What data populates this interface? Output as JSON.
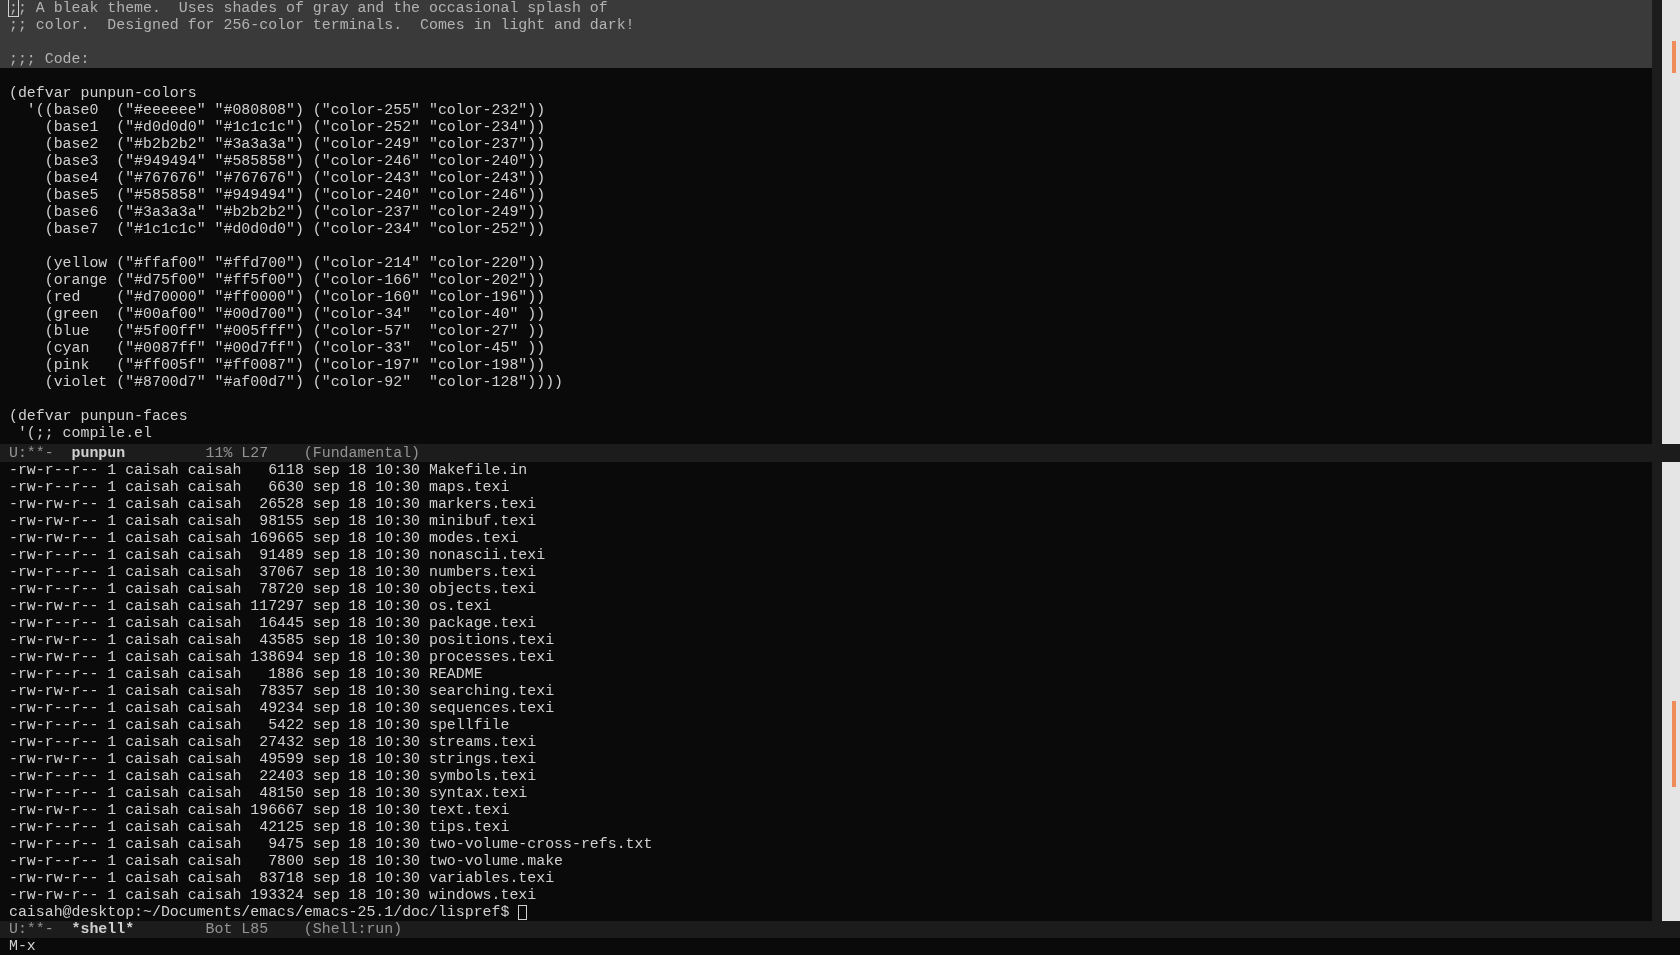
{
  "editor": {
    "lines": [
      {
        "text": ";; A bleak theme.  Uses shades of gray and the occasional splash of",
        "region": true,
        "cursor": true
      },
      {
        "text": ";; color.  Designed for 256-color terminals.  Comes in light and dark!",
        "region": true,
        "cursor": false
      },
      {
        "region": true
      },
      {
        "text": ";;; Code:",
        "region": true,
        "cursor": false
      },
      {
        "region": false
      },
      {
        "text": "(defvar punpun-colors",
        "region": false,
        "cursor": false
      },
      {
        "text": "  '((base0  (\"#eeeeee\" \"#080808\") (\"color-255\" \"color-232\"))",
        "region": false,
        "cursor": false
      },
      {
        "text": "    (base1  (\"#d0d0d0\" \"#1c1c1c\") (\"color-252\" \"color-234\"))",
        "region": false,
        "cursor": false
      },
      {
        "text": "    (base2  (\"#b2b2b2\" \"#3a3a3a\") (\"color-249\" \"color-237\"))",
        "region": false,
        "cursor": false
      },
      {
        "text": "    (base3  (\"#949494\" \"#585858\") (\"color-246\" \"color-240\"))",
        "region": false,
        "cursor": false
      },
      {
        "text": "    (base4  (\"#767676\" \"#767676\") (\"color-243\" \"color-243\"))",
        "region": false,
        "cursor": false
      },
      {
        "text": "    (base5  (\"#585858\" \"#949494\") (\"color-240\" \"color-246\"))",
        "region": false,
        "cursor": false
      },
      {
        "text": "    (base6  (\"#3a3a3a\" \"#b2b2b2\") (\"color-237\" \"color-249\"))",
        "region": false,
        "cursor": false
      },
      {
        "text": "    (base7  (\"#1c1c1c\" \"#d0d0d0\") (\"color-234\" \"color-252\"))",
        "region": false,
        "cursor": false
      },
      {
        "region": false
      },
      {
        "text": "    (yellow (\"#ffaf00\" \"#ffd700\") (\"color-214\" \"color-220\"))",
        "region": false,
        "cursor": false
      },
      {
        "text": "    (orange (\"#d75f00\" \"#ff5f00\") (\"color-166\" \"color-202\"))",
        "region": false,
        "cursor": false
      },
      {
        "text": "    (red    (\"#d70000\" \"#ff0000\") (\"color-160\" \"color-196\"))",
        "region": false,
        "cursor": false
      },
      {
        "text": "    (green  (\"#00af00\" \"#00d700\") (\"color-34\"  \"color-40\" ))",
        "region": false,
        "cursor": false
      },
      {
        "text": "    (blue   (\"#5f00ff\" \"#005fff\") (\"color-57\"  \"color-27\" ))",
        "region": false,
        "cursor": false
      },
      {
        "text": "    (cyan   (\"#0087ff\" \"#00d7ff\") (\"color-33\"  \"color-45\" ))",
        "region": false,
        "cursor": false
      },
      {
        "text": "    (pink   (\"#ff005f\" \"#ff0087\") (\"color-197\" \"color-198\"))",
        "region": false,
        "cursor": false
      },
      {
        "text": "    (violet (\"#8700d7\" \"#af00d7\") (\"color-92\"  \"color-128\"))))",
        "region": false,
        "cursor": false
      },
      {
        "region": false
      },
      {
        "text": "(defvar punpun-faces",
        "region": false,
        "cursor": false
      },
      {
        "text": " '(;; compile.el",
        "region": false,
        "cursor": false
      }
    ],
    "mode_line": {
      "status": "U:**-",
      "buffer": "punpun",
      "position": "11% L27",
      "mode": "(Fundamental)"
    }
  },
  "shell": {
    "lines": [
      "-rw-r--r-- 1 caisah caisah   6118 sep 18 10:30 Makefile.in",
      "-rw-r--r-- 1 caisah caisah   6630 sep 18 10:30 maps.texi",
      "-rw-rw-r-- 1 caisah caisah  26528 sep 18 10:30 markers.texi",
      "-rw-rw-r-- 1 caisah caisah  98155 sep 18 10:30 minibuf.texi",
      "-rw-rw-r-- 1 caisah caisah 169665 sep 18 10:30 modes.texi",
      "-rw-r--r-- 1 caisah caisah  91489 sep 18 10:30 nonascii.texi",
      "-rw-r--r-- 1 caisah caisah  37067 sep 18 10:30 numbers.texi",
      "-rw-r--r-- 1 caisah caisah  78720 sep 18 10:30 objects.texi",
      "-rw-rw-r-- 1 caisah caisah 117297 sep 18 10:30 os.texi",
      "-rw-r--r-- 1 caisah caisah  16445 sep 18 10:30 package.texi",
      "-rw-rw-r-- 1 caisah caisah  43585 sep 18 10:30 positions.texi",
      "-rw-rw-r-- 1 caisah caisah 138694 sep 18 10:30 processes.texi",
      "-rw-r--r-- 1 caisah caisah   1886 sep 18 10:30 README",
      "-rw-rw-r-- 1 caisah caisah  78357 sep 18 10:30 searching.texi",
      "-rw-r--r-- 1 caisah caisah  49234 sep 18 10:30 sequences.texi",
      "-rw-r--r-- 1 caisah caisah   5422 sep 18 10:30 spellfile",
      "-rw-r--r-- 1 caisah caisah  27432 sep 18 10:30 streams.texi",
      "-rw-rw-r-- 1 caisah caisah  49599 sep 18 10:30 strings.texi",
      "-rw-r--r-- 1 caisah caisah  22403 sep 18 10:30 symbols.texi",
      "-rw-r--r-- 1 caisah caisah  48150 sep 18 10:30 syntax.texi",
      "-rw-rw-r-- 1 caisah caisah 196667 sep 18 10:30 text.texi",
      "-rw-r--r-- 1 caisah caisah  42125 sep 18 10:30 tips.texi",
      "-rw-r--r-- 1 caisah caisah   9475 sep 18 10:30 two-volume-cross-refs.txt",
      "-rw-r--r-- 1 caisah caisah   7800 sep 18 10:30 two-volume.make",
      "-rw-rw-r-- 1 caisah caisah  83718 sep 18 10:30 variables.texi",
      "-rw-rw-r-- 1 caisah caisah 193324 sep 18 10:30 windows.texi"
    ],
    "prompt": {
      "text": "caisah@desktop:~/Documents/emacs/emacs-25.1/doc/lispref$",
      "cursor": true
    },
    "mode_line": {
      "status": "U:**-",
      "buffer": "*shell*",
      "position": "Bot L85",
      "mode": "(Shell:run)"
    }
  },
  "minibuffer": {
    "text": "M-x"
  }
}
